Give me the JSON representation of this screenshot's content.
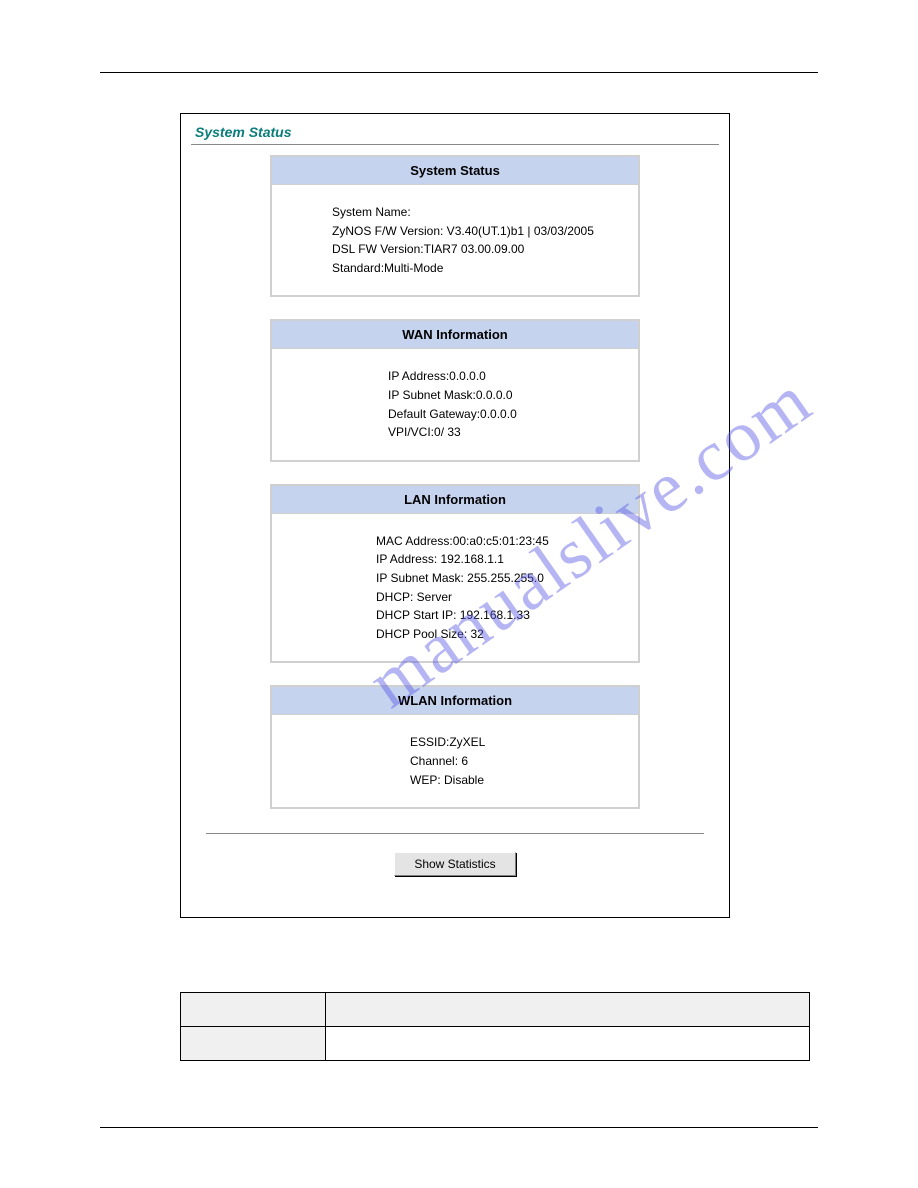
{
  "watermark": "manualslive.com",
  "panel": {
    "title": "System Status",
    "sections": {
      "system": {
        "header": "System Status",
        "lines": [
          "System Name:",
          "ZyNOS F/W Version: V3.40(UT.1)b1 | 03/03/2005",
          "DSL FW Version:TIAR7 03.00.09.00",
          "Standard:Multi-Mode"
        ]
      },
      "wan": {
        "header": "WAN Information",
        "lines": [
          "IP Address:0.0.0.0",
          "IP Subnet Mask:0.0.0.0",
          "Default Gateway:0.0.0.0",
          "VPI/VCI:0/ 33"
        ]
      },
      "lan": {
        "header": "LAN Information",
        "lines": [
          "MAC Address:00:a0:c5:01:23:45",
          "IP Address: 192.168.1.1",
          "IP Subnet Mask: 255.255.255.0",
          "DHCP: Server",
          "DHCP Start IP: 192.168.1.33",
          "DHCP Pool Size: 32"
        ]
      },
      "wlan": {
        "header": "WLAN Information",
        "lines": [
          "ESSID:ZyXEL",
          "Channel: 6",
          "WEP: Disable"
        ]
      }
    },
    "button": "Show Statistics"
  }
}
